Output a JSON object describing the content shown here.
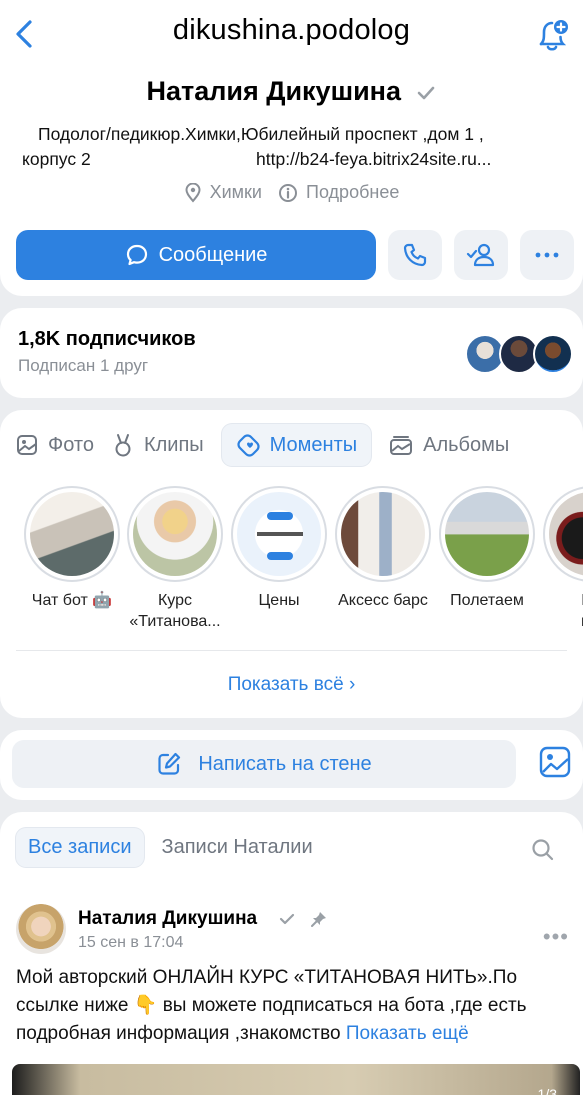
{
  "topbar": {
    "title": "dikushina.podolog"
  },
  "profile": {
    "name": "Наталия Дикушина",
    "bio_line1": "Подолог/педикюр.Химки,Юбилейный проспект ,дом 1 ,",
    "bio_line2": "корпус 2",
    "bio_url": "http://b24-feya.bitrix24site.ru...",
    "city": "Химки",
    "details": "Подробнее",
    "message_button": "Сообщение"
  },
  "followers": {
    "count": "1,8K подписчиков",
    "subscribed": "Подписан 1 друг"
  },
  "media": {
    "tabs": [
      {
        "label": "Фото",
        "icon": "photo-icon"
      },
      {
        "label": "Клипы",
        "icon": "clips-icon"
      },
      {
        "label": "Моменты",
        "icon": "moments-icon",
        "active": true
      },
      {
        "label": "Альбомы",
        "icon": "albums-icon"
      }
    ],
    "stories": [
      {
        "label": "Чат бот 🤖"
      },
      {
        "label": "Курс",
        "label2": "«Титанова..."
      },
      {
        "label": "Цены"
      },
      {
        "label": "Аксесс барс"
      },
      {
        "label": "Полетаем"
      },
      {
        "label": "Ба",
        "label2": "мо"
      }
    ],
    "show_all": "Показать всё ›"
  },
  "wall": {
    "write_label": "Написать на стене"
  },
  "posts": {
    "tabs": [
      {
        "label": "Все записи",
        "active": true
      },
      {
        "label": "Записи Наталии"
      }
    ],
    "post": {
      "author": "Наталия Дикушина",
      "date": "15 сен в 17:04",
      "text": "Мой авторский ОНЛАЙН КУРС «ТИТАНОВАЯ НИТЬ».По ссылке ниже 👇 вы можете подписаться на бота ,где есть подробная информация ,знакомство",
      "show_more": "Показать ещё",
      "image_counter": "1/3"
    }
  },
  "colors": {
    "accent": "#2d81e0",
    "background": "#ebedf0"
  }
}
